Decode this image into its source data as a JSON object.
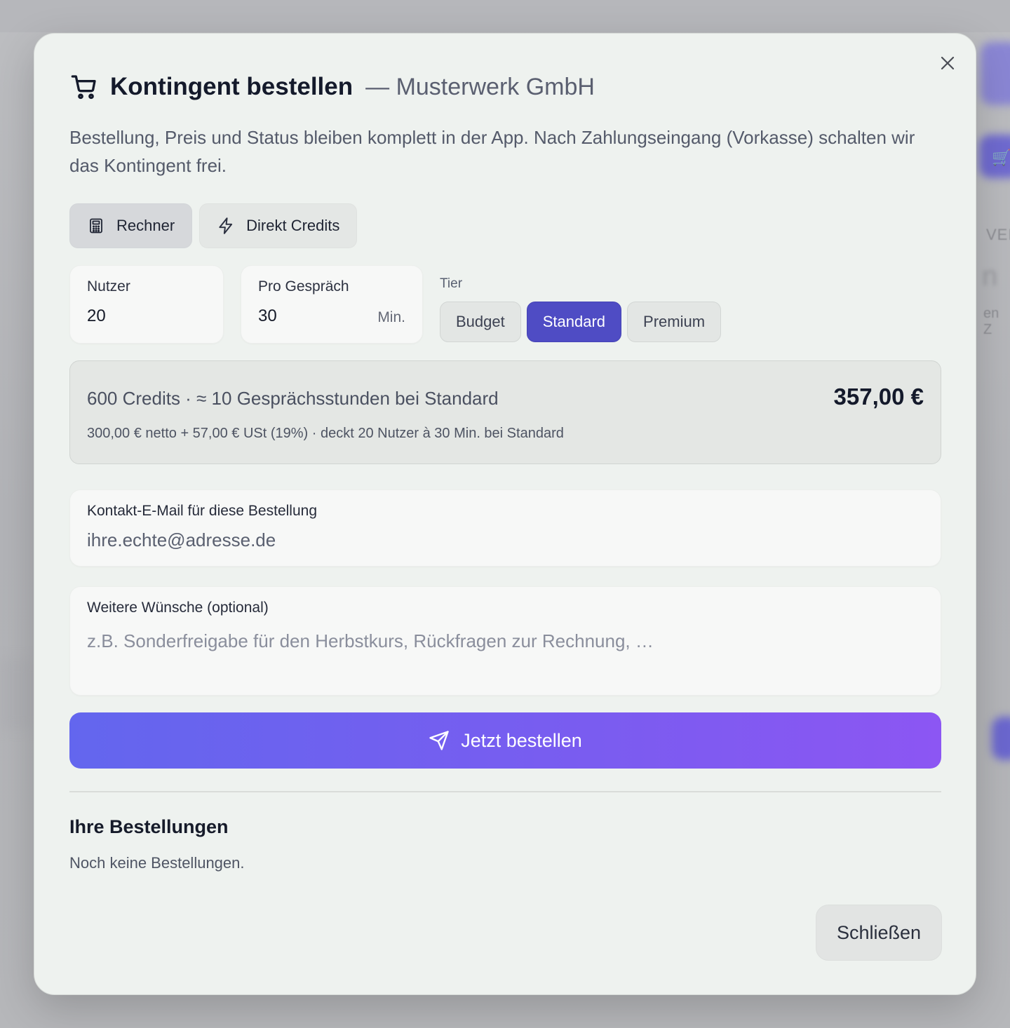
{
  "background": {
    "partial_text_1": "VEI",
    "partial_text_2": "n",
    "partial_text_3": "en Z"
  },
  "modal": {
    "close_icon": "x-icon",
    "title": "Kontingent bestellen",
    "title_suffix": "— Musterwerk GmbH",
    "description": "Bestellung, Preis und Status bleiben komplett in der App. Nach Zahlungseingang (Vorkasse) schalten wir das Kontingent frei.",
    "mode_tabs": [
      {
        "label": "Rechner",
        "icon": "calculator-icon",
        "active": true
      },
      {
        "label": "Direkt Credits",
        "icon": "lightning-icon",
        "active": false
      }
    ],
    "calculator": {
      "users_label": "Nutzer",
      "users_value": "20",
      "per_call_label": "Pro Gespräch",
      "per_call_value": "30",
      "per_call_unit": "Min.",
      "tier_label": "Tier",
      "tiers": [
        {
          "label": "Budget",
          "selected": false
        },
        {
          "label": "Standard",
          "selected": true
        },
        {
          "label": "Premium",
          "selected": false
        }
      ]
    },
    "summary": {
      "main": "600 Credits · ≈ 10 Gesprächsstunden bei Standard",
      "price": "357,00 €",
      "detail": "300,00 € netto + 57,00 € USt (19%) · deckt 20 Nutzer à 30 Min. bei Standard"
    },
    "email": {
      "label": "Kontakt-E-Mail für diese Bestellung",
      "value": "ihre.echte@adresse.de"
    },
    "notes": {
      "label": "Weitere Wünsche (optional)",
      "placeholder": "z.B. Sonderfreigabe für den Herbstkurs, Rückfragen zur Rechnung, …"
    },
    "order_button": "Jetzt bestellen",
    "orders_title": "Ihre Bestellungen",
    "orders_empty": "Noch keine Bestellungen.",
    "close_button": "Schließen"
  },
  "colors": {
    "accent": "#4f4cc4",
    "gradient_start": "#6366ee",
    "gradient_end": "#8c56f3",
    "modal_bg": "#eef2ef"
  }
}
